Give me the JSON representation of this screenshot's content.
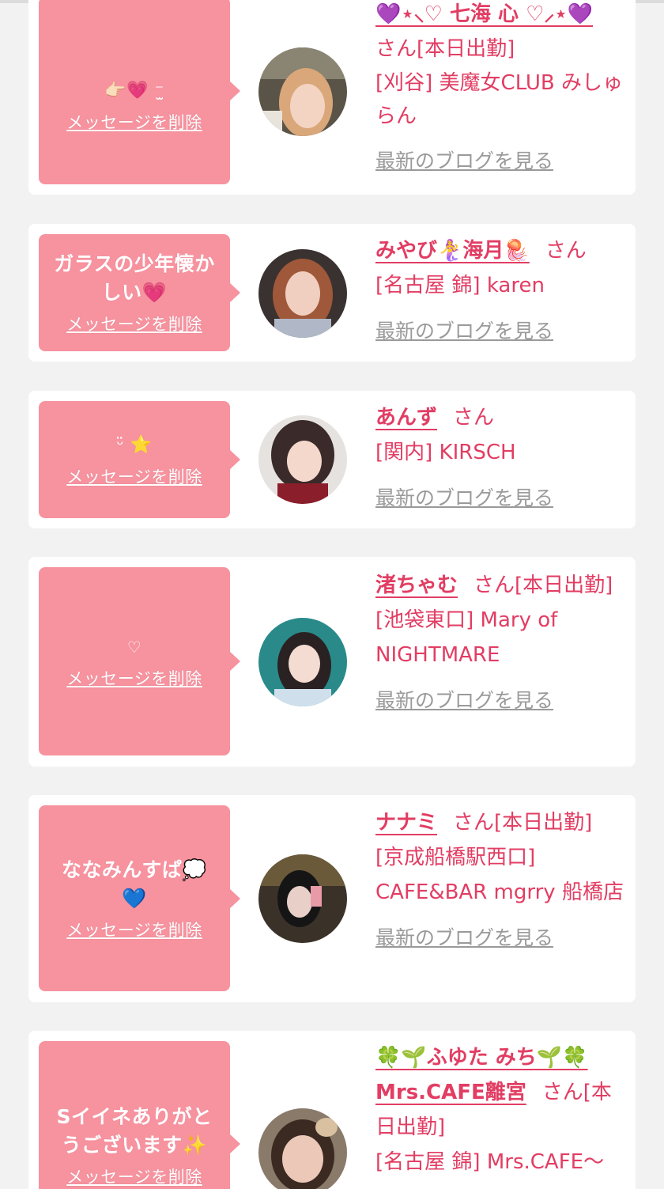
{
  "delete_label": "メッセージを削除",
  "blog_label": "最新のブログを見る",
  "cards": [
    {
      "message": "👉🏻💗 ⁻̫",
      "name": "💜⋆⸜♡ 七海 心 ♡⸝⋆💜",
      "suffix": "さん[本日出勤]",
      "shop": "[刈谷] 美魔女CLUB みしゅらん"
    },
    {
      "message": "ガラスの少年懐かしい💗",
      "name": "みやび🧜‍♀️海月🪼",
      "suffix": "さん",
      "shop": "[名古屋 錦] karen"
    },
    {
      "message": "ᵕ̈ ⭐",
      "name": "あんず",
      "suffix": "さん",
      "shop": "[関内] KIRSCH"
    },
    {
      "message": "♡",
      "name": "渚ちゃむ",
      "suffix": "さん[本日出勤]",
      "shop": "[池袋東口] Mary of NIGHTMARE"
    },
    {
      "message": "ななみんすぱ💭💙",
      "name": "ナナミ",
      "suffix": "さん[本日出勤]",
      "shop": "[京成船橋駅西口] CAFE&BAR mgrry 船橋店"
    },
    {
      "message": "Sイイネありがとうございます✨",
      "name": "🍀🌱ふゆた みち🌱🍀 Mrs.CAFE離宮",
      "suffix": "さん[本日出勤]",
      "shop": "[名古屋 錦] Mrs.CAFE〜"
    }
  ],
  "colors": {
    "page_bg": "#f2f2f2",
    "bubble": "#f7929f",
    "accent": "#e23d63",
    "link_gray": "#9a9a9a"
  }
}
